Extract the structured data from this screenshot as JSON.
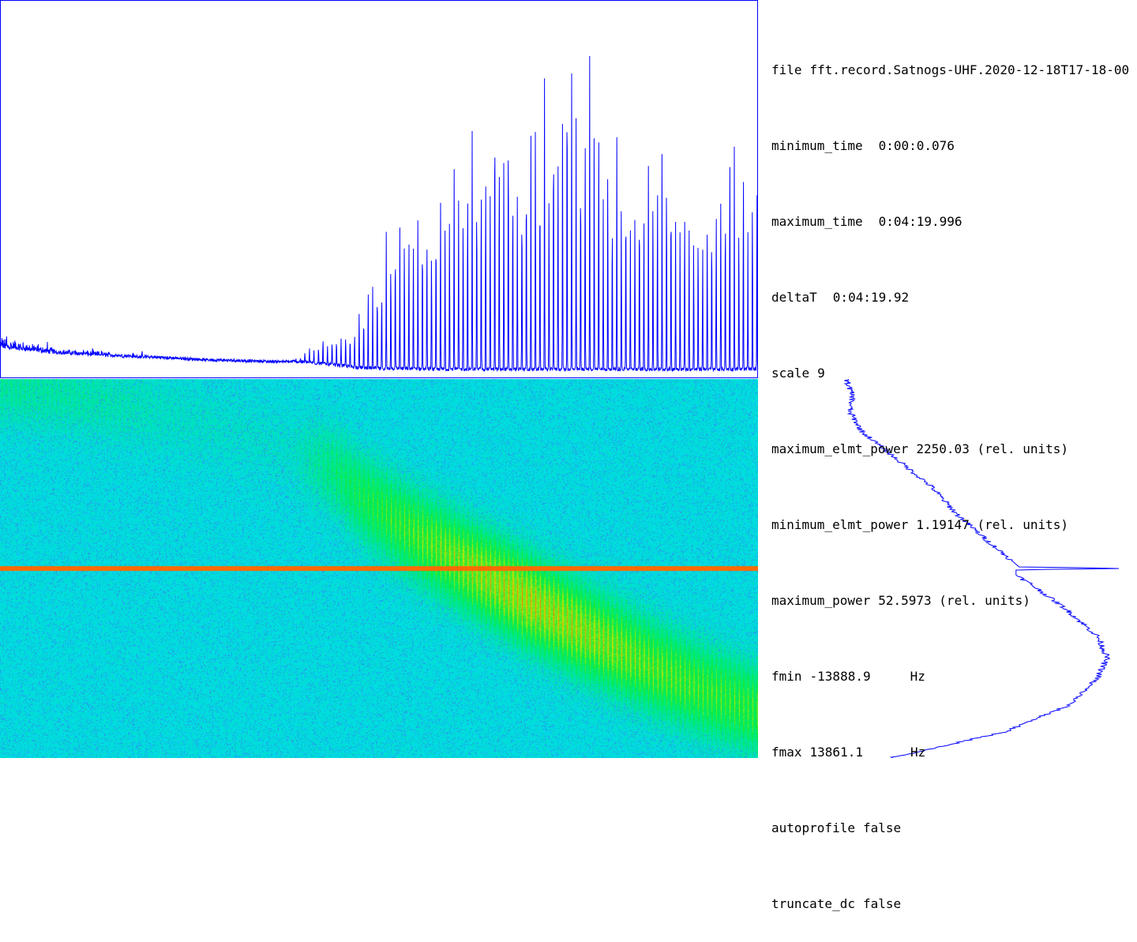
{
  "info": {
    "file": {
      "key": "file",
      "value": "fft.record.Satnogs-UHF.2020-12-18T17-18-00"
    },
    "minimum_time": {
      "key": "minimum_time",
      "value": "0:00:0.076"
    },
    "maximum_time": {
      "key": "maximum_time",
      "value": "0:04:19.996"
    },
    "deltaT": {
      "key": "deltaT",
      "value": "0:04:19.92"
    },
    "scale": {
      "key": "scale",
      "value": "9"
    },
    "maximum_elmt_power": {
      "key": "maximum_elmt_power",
      "value": "2250.03 (rel. units)"
    },
    "minimum_elmt_power": {
      "key": "minimum_elmt_power",
      "value": "1.19147 (rel. units)"
    },
    "maximum_power": {
      "key": "maximum_power",
      "value": "52.5973 (rel. units)"
    },
    "fmin": {
      "key": "fmin",
      "value": "-13888.9",
      "unit": "Hz"
    },
    "fmax": {
      "key": "fmax",
      "value": "13861.1",
      "unit": "Hz"
    },
    "autoprofile": {
      "key": "autoprofile",
      "value": "false"
    },
    "truncate_dc": {
      "key": "truncate_dc",
      "value": "false"
    }
  },
  "colors": {
    "trace": "#0000ff",
    "background": "#ffffff",
    "text": "#000000",
    "waterfall_base": "#00e0e0",
    "waterfall_signal": "#00e040",
    "carrier": "#ff6a00"
  },
  "chart_data": [
    {
      "type": "line",
      "name": "time-power-profile",
      "x_unit": "s",
      "xlim": [
        0.076,
        259.996
      ],
      "ylim": [
        0,
        52.5973
      ],
      "x": [
        0,
        10,
        20,
        30,
        40,
        50,
        60,
        70,
        80,
        90,
        100,
        105,
        110,
        115,
        120,
        125,
        130,
        140,
        150,
        160,
        170,
        180,
        190,
        200,
        210,
        220,
        230,
        240,
        250,
        260
      ],
      "envelope": [
        7.5,
        6.0,
        4.5,
        4.2,
        3.8,
        3.3,
        2.6,
        2.2,
        2.0,
        1.8,
        1.9,
        3.5,
        5.5,
        6.6,
        8.0,
        10.5,
        19.0,
        24.0,
        30.0,
        37.0,
        45.0,
        39.0,
        44.0,
        50.0,
        35.0,
        29.0,
        34.0,
        28.0,
        35.0,
        32.0
      ],
      "baseline": [
        4.0,
        3.6,
        3.2,
        3.0,
        2.8,
        2.6,
        2.5,
        2.3,
        2.2,
        2.1,
        2.0,
        1.9,
        1.7,
        1.5,
        1.3,
        1.1,
        1.0,
        1.0,
        0.9,
        0.9,
        0.9,
        0.9,
        0.9,
        0.9,
        0.9,
        0.9,
        0.9,
        0.9,
        0.9,
        0.9
      ],
      "peak_spacing_s": 1.55,
      "grid": false,
      "legend": "none"
    },
    {
      "type": "heatmap",
      "name": "waterfall",
      "x_unit": "s",
      "y_unit": "Hz",
      "xlim": [
        0.076,
        259.996
      ],
      "ylim": [
        -13888.9,
        13861.1
      ],
      "carrier_hz": 0,
      "doppler_track": {
        "t": [
          0,
          20,
          40,
          60,
          80,
          100,
          115,
          125,
          140,
          160,
          180,
          200,
          220,
          240,
          260
        ],
        "f": [
          13600,
          13000,
          12200,
          11200,
          10000,
          8600,
          7000,
          5000,
          2800,
          200,
          -2200,
          -4600,
          -6800,
          -8800,
          -10400
        ]
      },
      "track_intensity": [
        0.25,
        0.22,
        0.18,
        0.12,
        0.1,
        0.1,
        0.35,
        0.5,
        0.65,
        0.85,
        1.0,
        0.9,
        0.75,
        0.65,
        0.6
      ]
    },
    {
      "type": "line",
      "name": "frequency-power-profile",
      "x_unit": "rel. units",
      "y_unit": "Hz",
      "ylim": [
        -13888.9,
        13861.1
      ],
      "f": [
        13861,
        12600,
        11500,
        10000,
        8000,
        6000,
        4000,
        2000,
        500,
        100,
        0,
        -100,
        -500,
        -1200,
        -3000,
        -5000,
        -6500,
        -8000,
        -10000,
        -12000,
        -13889
      ],
      "power": [
        8.0,
        10.0,
        9.0,
        13.0,
        24.0,
        35.0,
        43.0,
        53.0,
        61.0,
        63.0,
        100.0,
        62.0,
        62.0,
        67.0,
        78.0,
        88.0,
        91.0,
        88.0,
        79.0,
        58.0,
        22.0
      ],
      "xlim": [
        0,
        100
      ]
    }
  ]
}
